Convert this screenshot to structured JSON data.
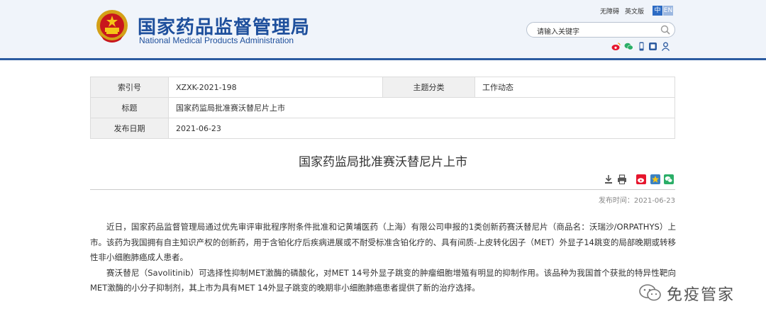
{
  "header": {
    "org_name_cn": "国家药品监督管理局",
    "org_name_en": "National Medical Products Administration",
    "links": [
      "无障碍",
      "英文版"
    ],
    "lang_zh": "中",
    "lang_en": "EN",
    "search_text": "请输入关键字"
  },
  "info": {
    "index_label": "索引号",
    "index_value": "XZXK-2021-198",
    "category_label": "主题分类",
    "category_value": "工作动态",
    "title_label": "标题",
    "title_value": "国家药监局批准赛沃替尼片上市",
    "date_label": "发布日期",
    "date_value": "2021-06-23"
  },
  "article": {
    "title": "国家药监局批准赛沃替尼片上市",
    "pubdate": "发布时间：2021-06-23",
    "paragraphs": [
      "近日，国家药品监督管理局通过优先审评审批程序附条件批准和记黄埔医药（上海）有限公司申报的1类创新药赛沃替尼片（商品名：沃瑞沙/ORPATHYS）上市。该药为我国拥有自主知识产权的创新药，用于含铂化疗后疾病进展或不耐受标准含铂化疗的、具有间质-上皮转化因子（MET）外显子14跳变的局部晚期或转移性非小细胞肺癌成人患者。",
      "赛沃替尼（Savolitinib）可选择性抑制MET激酶的磷酸化，对MET 14号外显子跳变的肿瘤细胞增殖有明显的抑制作用。该品种为我国首个获批的特异性靶向MET激酶的小分子抑制剂，其上市为具有MET 14外显子跳变的晚期非小细胞肺癌患者提供了新的治疗选择。"
    ]
  },
  "watermark": {
    "text": "免疫管家"
  },
  "colors": {
    "brand_blue": "#1e4f9c",
    "header_bg": "#f0f4fa",
    "header_rule": "#2c5ba0"
  }
}
